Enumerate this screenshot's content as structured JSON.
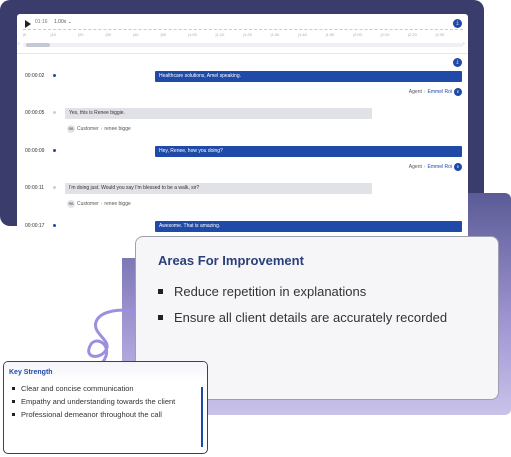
{
  "player": {
    "time": "01:16",
    "speed": "1.00x",
    "speed_arrow": "⌄",
    "ruler_labels": [
      "|0",
      "|10",
      "|20",
      "|30",
      "|40",
      "|50",
      "|1:00",
      "|1:10",
      "|1:20",
      "|1:30",
      "|1:40",
      "|1:50",
      "|2:00",
      "|2:10",
      "|2:20",
      "|2:30"
    ],
    "scroll_left": "‹",
    "scroll_right": "›"
  },
  "transcript": {
    "messages": [
      {
        "time": "00:00:02",
        "text": "Healthcare solutions, Amel speaking.",
        "role_label": "Agent",
        "name": "Emmel Roi",
        "initials": "E"
      },
      {
        "time": "00:00:05",
        "text": "Yes, this is Renee biggie.",
        "role_label": "Customer",
        "name": "renee bigge",
        "initials": "RB"
      },
      {
        "time": "00:00:09",
        "text": "Hey, Renee, how you doing?",
        "role_label": "Agent",
        "name": "Emmel Roi",
        "initials": "E"
      },
      {
        "time": "00:00:11",
        "text": "I'm doing just. Would you say I'm blessed to be a walk, sir?",
        "role_label": "Customer",
        "name": "renee bigge",
        "initials": "RB"
      },
      {
        "time": "00:00:17",
        "text": "Awesome. That is amazing."
      }
    ]
  },
  "improvement": {
    "title": "Areas For Improvement",
    "items": [
      "Reduce repetition in explanations",
      "Ensure all client details are accurately recorded"
    ]
  },
  "strengths": {
    "title": "Key Strength",
    "items": [
      "Clear and concise communication",
      "Empathy and understanding towards the client",
      "Professional demeanor throughout the call"
    ]
  },
  "icons": {
    "download": "⤓",
    "chevron": "›"
  }
}
